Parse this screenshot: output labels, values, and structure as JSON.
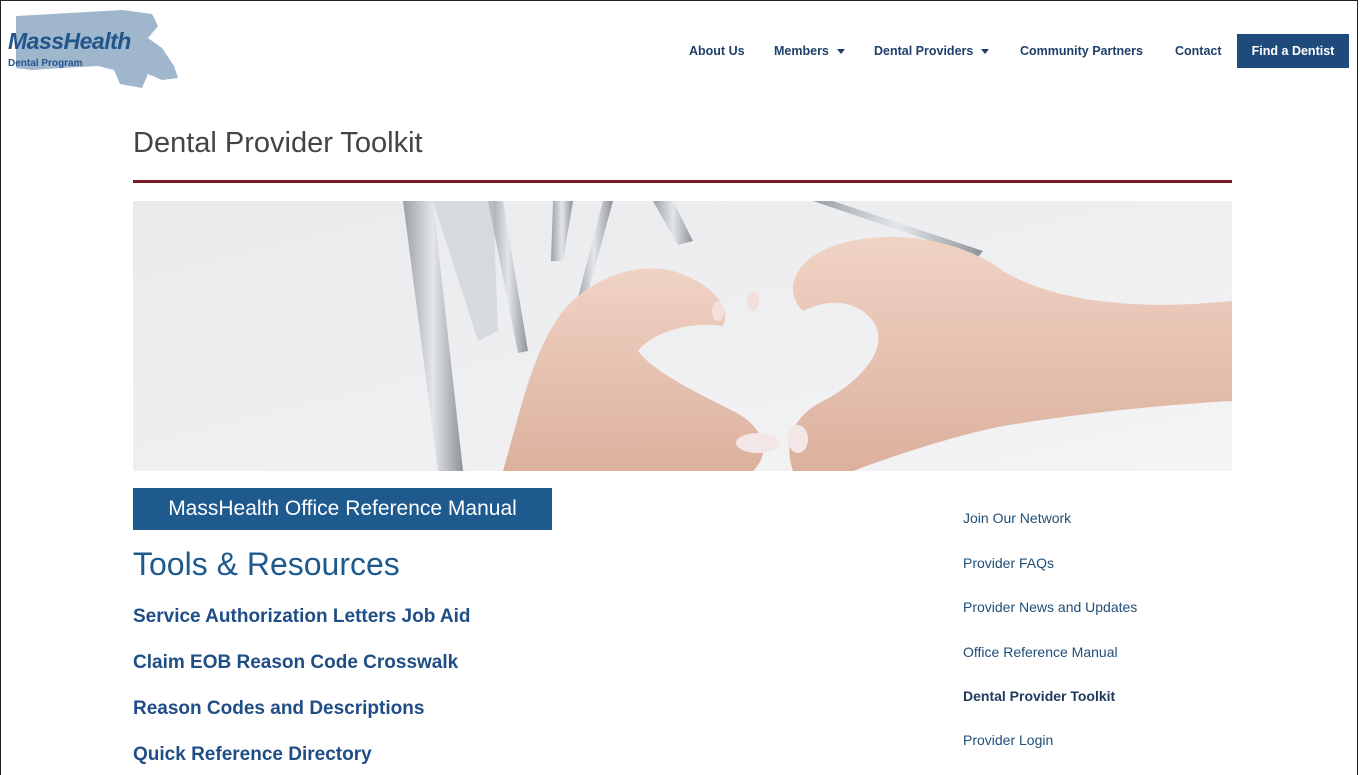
{
  "logo": {
    "title": "MassHealth",
    "subtitle": "Dental Program"
  },
  "nav": {
    "items": [
      {
        "label": "About Us",
        "dropdown": false
      },
      {
        "label": "Members",
        "dropdown": true
      },
      {
        "label": "Dental Providers",
        "dropdown": true
      },
      {
        "label": "Community Partners",
        "dropdown": false
      },
      {
        "label": "Contact",
        "dropdown": false
      }
    ],
    "cta": "Find a Dentist"
  },
  "page": {
    "title": "Dental Provider Toolkit"
  },
  "main": {
    "manual_button": "MassHealth Office Reference Manual",
    "section_title": "Tools & Resources",
    "resources": [
      "Service Authorization Letters Job Aid",
      "Claim EOB Reason Code Crosswalk",
      "Reason Codes and Descriptions",
      "Quick Reference Directory"
    ]
  },
  "sidebar": {
    "links": [
      {
        "label": "Join Our Network",
        "active": false
      },
      {
        "label": "Provider FAQs",
        "active": false
      },
      {
        "label": "Provider News and Updates",
        "active": false
      },
      {
        "label": "Office Reference Manual",
        "active": false
      },
      {
        "label": "Dental Provider Toolkit",
        "active": true
      },
      {
        "label": "Provider Login",
        "active": false
      }
    ]
  },
  "colors": {
    "brand": "#1f4a7c",
    "accent_rule": "#7a1a24",
    "link": "#1f4e86"
  }
}
